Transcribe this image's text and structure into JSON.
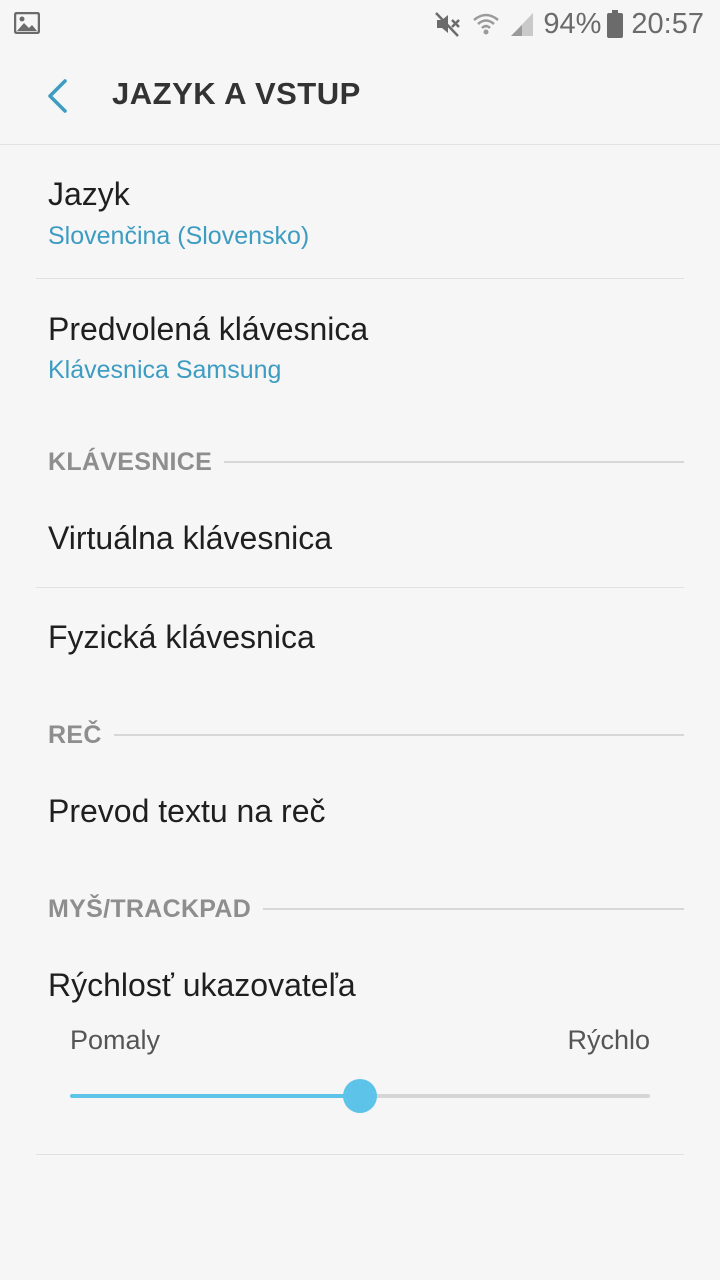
{
  "status_bar": {
    "battery_percent": "94%",
    "time": "20:57",
    "icons": [
      "gallery-icon",
      "mute-icon",
      "wifi-icon",
      "signal-icon",
      "battery-icon"
    ]
  },
  "header": {
    "title": "JAZYK A VSTUP"
  },
  "items": {
    "language": {
      "title": "Jazyk",
      "value": "Slovenčina (Slovensko)"
    },
    "default_keyboard": {
      "title": "Predvolená klávesnica",
      "value": "Klávesnica Samsung"
    }
  },
  "sections": {
    "keyboards": {
      "label": "KLÁVESNICE",
      "items": [
        "Virtuálna klávesnica",
        "Fyzická klávesnica"
      ]
    },
    "speech": {
      "label": "REČ",
      "items": [
        "Prevod textu na reč"
      ]
    },
    "mouse": {
      "label": "MYŠ/TRACKPAD",
      "pointer_speed": {
        "title": "Rýchlosť ukazovateľa",
        "min_label": "Pomaly",
        "max_label": "Rýchlo",
        "value_fraction": 0.5
      }
    }
  },
  "colors": {
    "accent": "#3d9cc1",
    "slider": "#5ec3e8",
    "background": "#f6f6f6"
  }
}
